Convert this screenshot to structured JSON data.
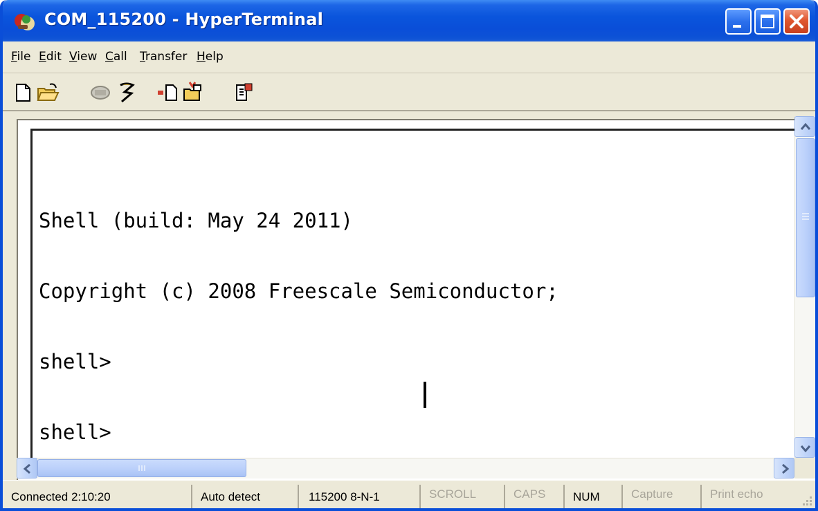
{
  "window": {
    "title": "COM_115200 - HyperTerminal",
    "accent": "#0a4ed8",
    "close_color": "#d9532e"
  },
  "menu": {
    "items": [
      {
        "first": "F",
        "rest": "ile"
      },
      {
        "first": "E",
        "rest": "dit"
      },
      {
        "first": "V",
        "rest": "iew"
      },
      {
        "first": "C",
        "rest": "all"
      },
      {
        "first": "T",
        "rest": "ransfer"
      },
      {
        "first": "H",
        "rest": "elp"
      }
    ]
  },
  "toolbar": {
    "icons": [
      "new-icon",
      "open-icon",
      "disconnect-icon",
      "connect-icon",
      "send-icon",
      "receive-icon",
      "properties-icon"
    ]
  },
  "terminal": {
    "lines": [
      "Shell (build: May 24 2011)",
      "Copyright (c) 2008 Freescale Semiconductor;",
      "shell>",
      "shell>"
    ]
  },
  "status": {
    "connected": "Connected 2:10:20",
    "detect": "Auto detect",
    "port": "115200 8-N-1",
    "scroll": "SCROLL",
    "caps": "CAPS",
    "num": "NUM",
    "capture": "Capture",
    "print_echo": "Print echo"
  }
}
